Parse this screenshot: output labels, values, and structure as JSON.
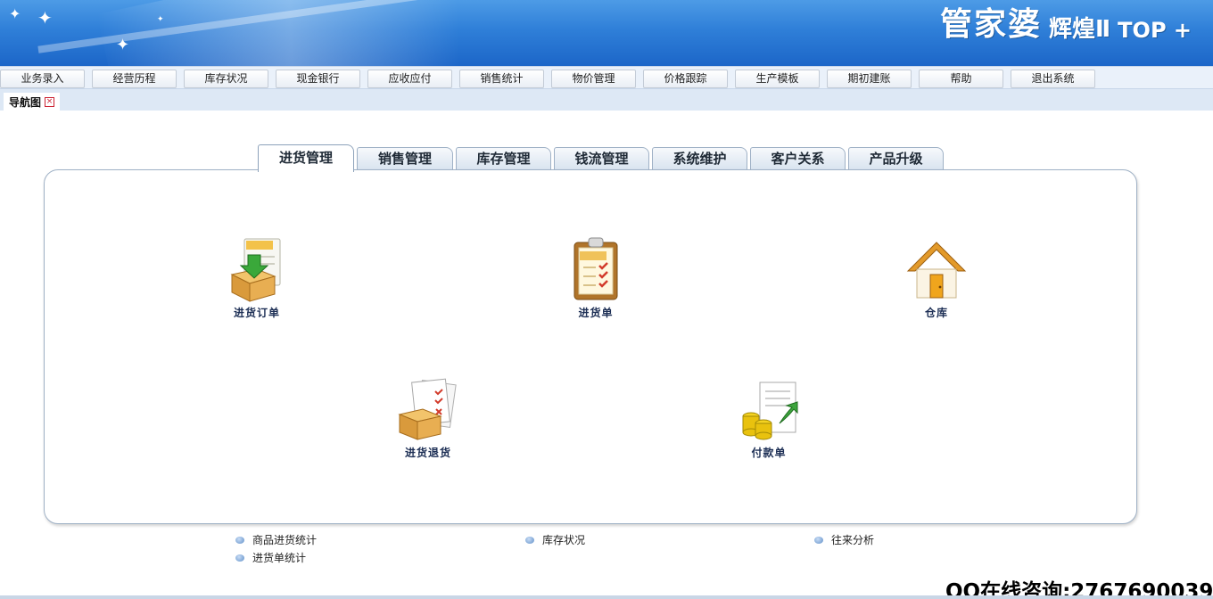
{
  "brand": {
    "name": "管家婆",
    "edition": "辉煌Ⅱ",
    "suffix": "TOP +"
  },
  "menu": [
    {
      "label": "业务录入"
    },
    {
      "label": "经营历程"
    },
    {
      "label": "库存状况"
    },
    {
      "label": "现金银行"
    },
    {
      "label": "应收应付"
    },
    {
      "label": "销售统计"
    },
    {
      "label": "物价管理"
    },
    {
      "label": "价格跟踪"
    },
    {
      "label": "生产模板"
    },
    {
      "label": "期初建账"
    },
    {
      "label": "帮助"
    },
    {
      "label": "退出系统"
    }
  ],
  "nav_tab": {
    "label": "导航图",
    "close_glyph": "×"
  },
  "tabs": [
    {
      "label": "进货管理",
      "active": true
    },
    {
      "label": "销售管理"
    },
    {
      "label": "库存管理"
    },
    {
      "label": "钱流管理"
    },
    {
      "label": "系统维护"
    },
    {
      "label": "客户关系"
    },
    {
      "label": "产品升级"
    }
  ],
  "items": [
    {
      "label": "进货订单",
      "icon": "purchase-order-icon"
    },
    {
      "label": "进货单",
      "icon": "clipboard-checklist-icon"
    },
    {
      "label": "仓库",
      "icon": "warehouse-house-icon"
    },
    {
      "label": "进货退货",
      "icon": "purchase-return-icon"
    },
    {
      "label": "付款单",
      "icon": "payment-coins-icon"
    }
  ],
  "links": [
    {
      "label": "商品进货统计"
    },
    {
      "label": "库存状况"
    },
    {
      "label": "往来分析"
    },
    {
      "label": "进货单统计"
    }
  ],
  "footer": {
    "qq_text": "QQ在线咨询:2767690039"
  },
  "colors": {
    "banner": "#2f7fd8",
    "menu_bg": "#eaf1fa",
    "label_text": "#1d2f55"
  }
}
